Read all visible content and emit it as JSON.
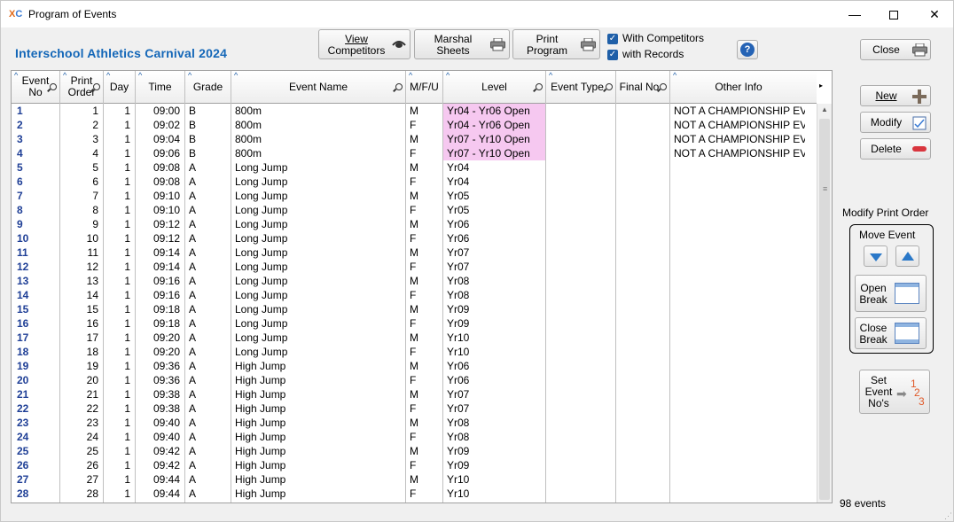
{
  "window": {
    "title": "Program of Events",
    "min_glyph": "—",
    "close_glyph": "✕"
  },
  "carnival_title": "Interschool Athletics Carnival 2024",
  "toolbar": {
    "view_competitors": [
      "View",
      "Competitors"
    ],
    "marshal_sheets": [
      "Marshal",
      "Sheets"
    ],
    "print_program": [
      "Print",
      "Program"
    ],
    "with_competitors": "With Competitors",
    "with_records": "with Records",
    "help": "?",
    "close": "Close"
  },
  "columns": {
    "event_no": [
      "Event",
      "No"
    ],
    "print_order": [
      "Print",
      "Order"
    ],
    "day": "Day",
    "time": "Time",
    "grade": "Grade",
    "event_name": "Event Name",
    "mfu": "M/F/U",
    "level": "Level",
    "event_type": "Event Type",
    "final_no": "Final No",
    "other_info": "Other Info"
  },
  "rows": [
    {
      "event": "1",
      "order": "1",
      "day": "1",
      "time": "09:00",
      "grade": "B",
      "name": "800m",
      "mfu": "M",
      "level": "Yr04 - Yr06 Open",
      "hl": true,
      "info": "NOT A CHAMPIONSHIP EVENT"
    },
    {
      "event": "2",
      "order": "2",
      "day": "1",
      "time": "09:02",
      "grade": "B",
      "name": "800m",
      "mfu": "F",
      "level": "Yr04 - Yr06 Open",
      "hl": true,
      "info": "NOT A CHAMPIONSHIP EVENT"
    },
    {
      "event": "3",
      "order": "3",
      "day": "1",
      "time": "09:04",
      "grade": "B",
      "name": "800m",
      "mfu": "M",
      "level": "Yr07 - Yr10 Open",
      "hl": true,
      "info": "NOT A CHAMPIONSHIP EVENT"
    },
    {
      "event": "4",
      "order": "4",
      "day": "1",
      "time": "09:06",
      "grade": "B",
      "name": "800m",
      "mfu": "F",
      "level": "Yr07 - Yr10 Open",
      "hl": true,
      "info": "NOT A CHAMPIONSHIP EVENT"
    },
    {
      "event": "5",
      "order": "5",
      "day": "1",
      "time": "09:08",
      "grade": "A",
      "name": "Long Jump",
      "mfu": "M",
      "level": "Yr04",
      "hl": false,
      "info": ""
    },
    {
      "event": "6",
      "order": "6",
      "day": "1",
      "time": "09:08",
      "grade": "A",
      "name": "Long Jump",
      "mfu": "F",
      "level": "Yr04",
      "hl": false,
      "info": ""
    },
    {
      "event": "7",
      "order": "7",
      "day": "1",
      "time": "09:10",
      "grade": "A",
      "name": "Long Jump",
      "mfu": "M",
      "level": "Yr05",
      "hl": false,
      "info": ""
    },
    {
      "event": "8",
      "order": "8",
      "day": "1",
      "time": "09:10",
      "grade": "A",
      "name": "Long Jump",
      "mfu": "F",
      "level": "Yr05",
      "hl": false,
      "info": ""
    },
    {
      "event": "9",
      "order": "9",
      "day": "1",
      "time": "09:12",
      "grade": "A",
      "name": "Long Jump",
      "mfu": "M",
      "level": "Yr06",
      "hl": false,
      "info": ""
    },
    {
      "event": "10",
      "order": "10",
      "day": "1",
      "time": "09:12",
      "grade": "A",
      "name": "Long Jump",
      "mfu": "F",
      "level": "Yr06",
      "hl": false,
      "info": ""
    },
    {
      "event": "11",
      "order": "11",
      "day": "1",
      "time": "09:14",
      "grade": "A",
      "name": "Long Jump",
      "mfu": "M",
      "level": "Yr07",
      "hl": false,
      "info": ""
    },
    {
      "event": "12",
      "order": "12",
      "day": "1",
      "time": "09:14",
      "grade": "A",
      "name": "Long Jump",
      "mfu": "F",
      "level": "Yr07",
      "hl": false,
      "info": ""
    },
    {
      "event": "13",
      "order": "13",
      "day": "1",
      "time": "09:16",
      "grade": "A",
      "name": "Long Jump",
      "mfu": "M",
      "level": "Yr08",
      "hl": false,
      "info": ""
    },
    {
      "event": "14",
      "order": "14",
      "day": "1",
      "time": "09:16",
      "grade": "A",
      "name": "Long Jump",
      "mfu": "F",
      "level": "Yr08",
      "hl": false,
      "info": ""
    },
    {
      "event": "15",
      "order": "15",
      "day": "1",
      "time": "09:18",
      "grade": "A",
      "name": "Long Jump",
      "mfu": "M",
      "level": "Yr09",
      "hl": false,
      "info": ""
    },
    {
      "event": "16",
      "order": "16",
      "day": "1",
      "time": "09:18",
      "grade": "A",
      "name": "Long Jump",
      "mfu": "F",
      "level": "Yr09",
      "hl": false,
      "info": ""
    },
    {
      "event": "17",
      "order": "17",
      "day": "1",
      "time": "09:20",
      "grade": "A",
      "name": "Long Jump",
      "mfu": "M",
      "level": "Yr10",
      "hl": false,
      "info": ""
    },
    {
      "event": "18",
      "order": "18",
      "day": "1",
      "time": "09:20",
      "grade": "A",
      "name": "Long Jump",
      "mfu": "F",
      "level": "Yr10",
      "hl": false,
      "info": ""
    },
    {
      "event": "19",
      "order": "19",
      "day": "1",
      "time": "09:36",
      "grade": "A",
      "name": "High Jump",
      "mfu": "M",
      "level": "Yr06",
      "hl": false,
      "info": ""
    },
    {
      "event": "20",
      "order": "20",
      "day": "1",
      "time": "09:36",
      "grade": "A",
      "name": "High Jump",
      "mfu": "F",
      "level": "Yr06",
      "hl": false,
      "info": ""
    },
    {
      "event": "21",
      "order": "21",
      "day": "1",
      "time": "09:38",
      "grade": "A",
      "name": "High Jump",
      "mfu": "M",
      "level": "Yr07",
      "hl": false,
      "info": ""
    },
    {
      "event": "22",
      "order": "22",
      "day": "1",
      "time": "09:38",
      "grade": "A",
      "name": "High Jump",
      "mfu": "F",
      "level": "Yr07",
      "hl": false,
      "info": ""
    },
    {
      "event": "23",
      "order": "23",
      "day": "1",
      "time": "09:40",
      "grade": "A",
      "name": "High Jump",
      "mfu": "M",
      "level": "Yr08",
      "hl": false,
      "info": ""
    },
    {
      "event": "24",
      "order": "24",
      "day": "1",
      "time": "09:40",
      "grade": "A",
      "name": "High Jump",
      "mfu": "F",
      "level": "Yr08",
      "hl": false,
      "info": ""
    },
    {
      "event": "25",
      "order": "25",
      "day": "1",
      "time": "09:42",
      "grade": "A",
      "name": "High Jump",
      "mfu": "M",
      "level": "Yr09",
      "hl": false,
      "info": ""
    },
    {
      "event": "26",
      "order": "26",
      "day": "1",
      "time": "09:42",
      "grade": "A",
      "name": "High Jump",
      "mfu": "F",
      "level": "Yr09",
      "hl": false,
      "info": ""
    },
    {
      "event": "27",
      "order": "27",
      "day": "1",
      "time": "09:44",
      "grade": "A",
      "name": "High Jump",
      "mfu": "M",
      "level": "Yr10",
      "hl": false,
      "info": ""
    },
    {
      "event": "28",
      "order": "28",
      "day": "1",
      "time": "09:44",
      "grade": "A",
      "name": "High Jump",
      "mfu": "F",
      "level": "Yr10",
      "hl": false,
      "info": ""
    }
  ],
  "side": {
    "new": "New",
    "modify": "Modify",
    "delete": "Delete",
    "modify_print_order": "Modify Print Order",
    "move_event": "Move Event",
    "open_break": [
      "Open",
      "Break"
    ],
    "close_break": [
      "Close",
      "Break"
    ],
    "set_event_nos": [
      "Set",
      "Event",
      "No's"
    ],
    "set_icon_digits": [
      "1",
      "2",
      "3"
    ]
  },
  "events_count": "98 events",
  "colors": {
    "accent": "#1467b8",
    "highlight": "#f6c8f0",
    "event_no": "#1f3f96"
  },
  "icons": [
    "app-icon",
    "eye-icon",
    "printer-icon",
    "help-icon",
    "plus-icon",
    "edit-icon",
    "delete-icon",
    "down-arrow-icon",
    "up-arrow-icon",
    "open-break-icon",
    "close-break-icon",
    "numbering-icon"
  ]
}
